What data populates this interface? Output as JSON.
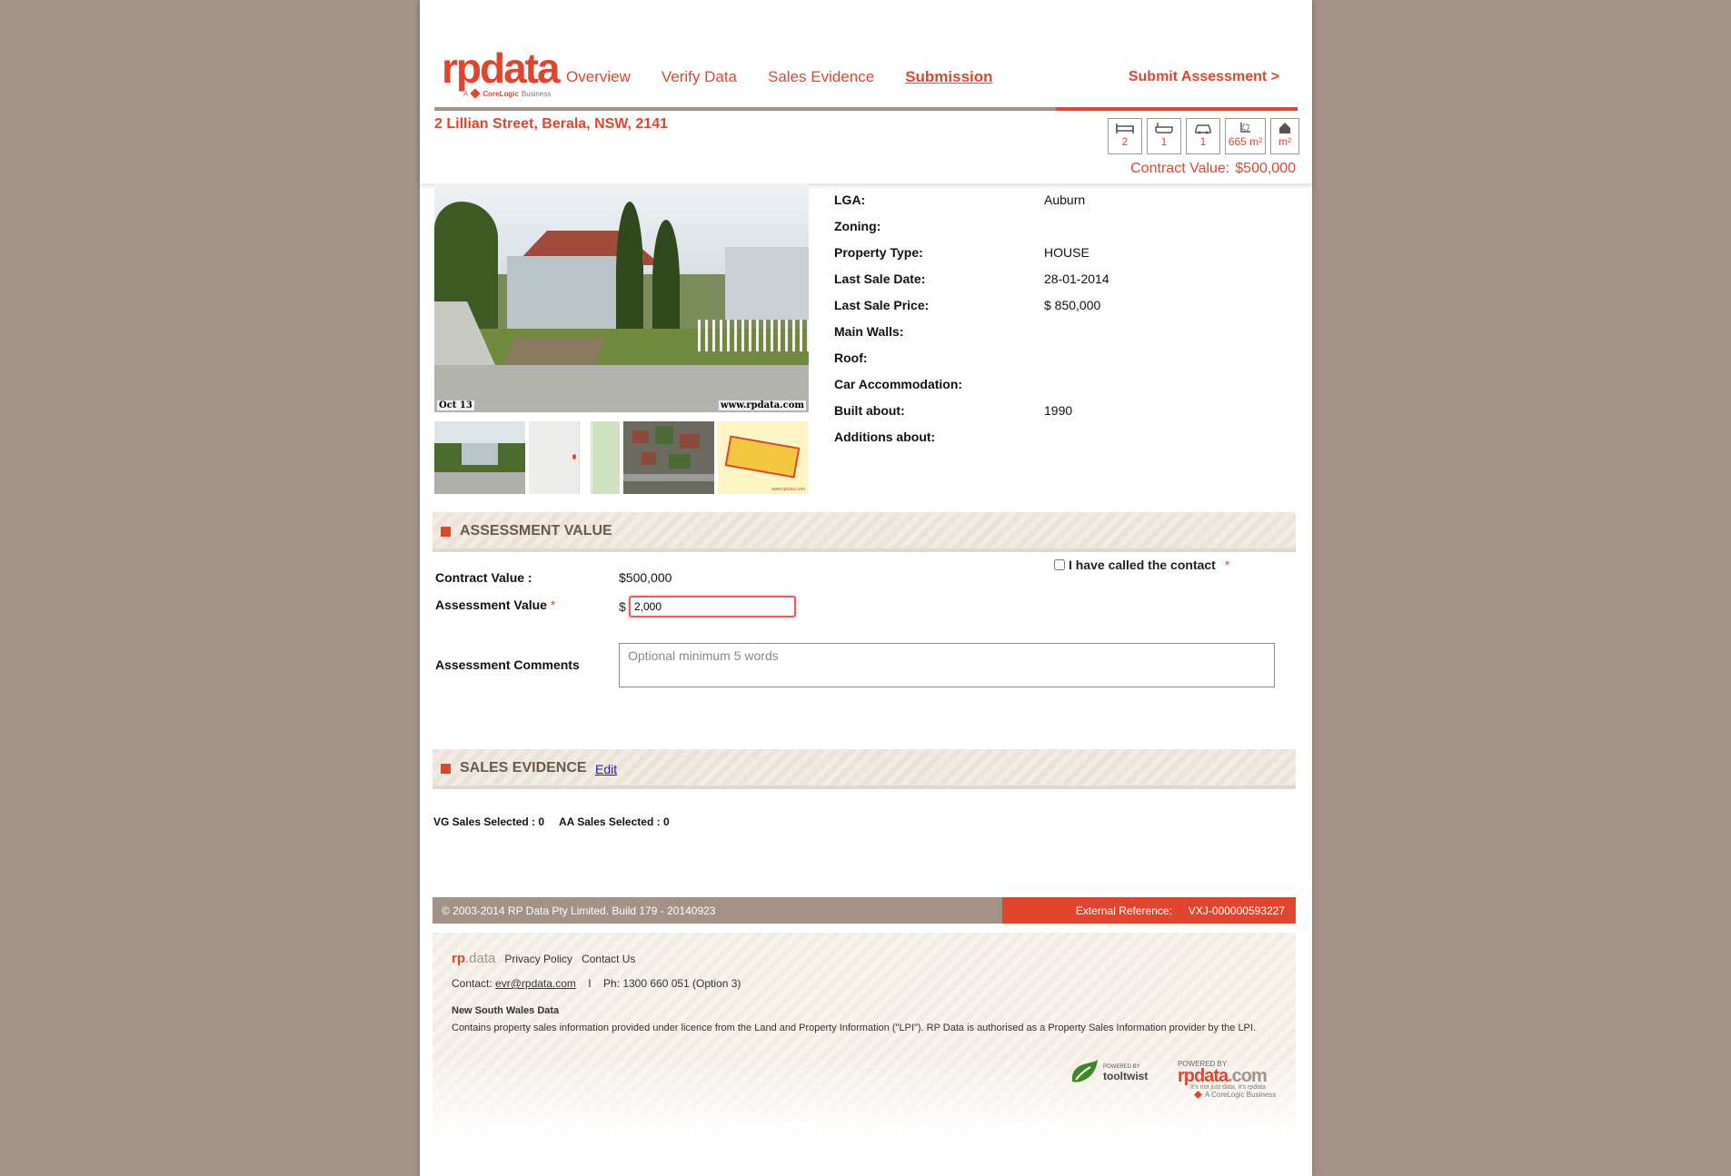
{
  "header": {
    "logo_text": "rpdata",
    "logo_sub_prefix": "A",
    "logo_sub_brand": "CoreLogic",
    "logo_sub_suffix": "Business",
    "nav": [
      "Overview",
      "Verify Data",
      "Sales Evidence",
      "Submission"
    ],
    "active_nav": "Submission",
    "submit_label": "Submit Assessment >",
    "progress_percent": 28
  },
  "property": {
    "address": "2 Lillian Street, Berala, NSW, 2141",
    "features": [
      {
        "icon": "bed-icon",
        "value": "2"
      },
      {
        "icon": "bath-icon",
        "value": "1"
      },
      {
        "icon": "car-icon",
        "value": "1"
      },
      {
        "icon": "land-area-icon",
        "value": "665 m²"
      },
      {
        "icon": "floor-area-icon",
        "value": "m²"
      }
    ],
    "contract_value_label": "Contract Value:",
    "contract_value": "$500,000",
    "photo_date": "Oct 13",
    "photo_watermark": "www.rpdata.com",
    "details": [
      {
        "label": "LGA:",
        "value": "Auburn"
      },
      {
        "label": "Zoning:",
        "value": ""
      },
      {
        "label": "Property Type:",
        "value": "HOUSE"
      },
      {
        "label": "Last Sale Date:",
        "value": "28-01-2014"
      },
      {
        "label": "Last Sale Price:",
        "value": "$ 850,000"
      },
      {
        "label": "Main Walls:",
        "value": ""
      },
      {
        "label": "Roof:",
        "value": ""
      },
      {
        "label": "Car Accommodation:",
        "value": ""
      },
      {
        "label": "Built about:",
        "value": "1990"
      },
      {
        "label": "Additions about:",
        "value": ""
      }
    ]
  },
  "assessment": {
    "title": "ASSESSMENT VALUE",
    "called_contact_label": "I have called the contact",
    "required_mark": "*",
    "contract_value_label": "Contract Value :",
    "contract_value": "$500,000",
    "assessment_value_label": "Assessment Value",
    "currency": "$",
    "assessment_value": "2,000",
    "comments_label": "Assessment Comments",
    "comments_placeholder": "Optional minimum 5 words"
  },
  "sales_evidence": {
    "title": "SALES EVIDENCE",
    "edit_label": "Edit",
    "vg_selected": "VG Sales Selected : 0",
    "aa_selected": "AA Sales Selected : 0"
  },
  "footer": {
    "copyright": "© 2003-2014 RP Data Pty Limited.  Build 179 - 20140923",
    "ext_ref_label": "External Reference:",
    "ext_ref_value": "VXJ-000000593227",
    "brand_rp": "rp",
    "brand_data": ".data",
    "links": [
      "Privacy Policy",
      "Contact Us"
    ],
    "contact_label": "Contact:",
    "contact_email": "evr@rpdata.com",
    "separator": "I",
    "phone": "Ph: 1300 660 051 (Option 3)",
    "nsw_title": "New South Wales Data",
    "licence_text": "Contains property sales information provided under licence from the Land and Property Information (\"LPI\"). RP Data is authorised as a Property Sales Information provider by the LPI.",
    "tooltwist_small": "POWERED BY",
    "tooltwist_name": "tooltwist",
    "rp_powered": "POWERED BY",
    "rp_site_main": "rpdata",
    "rp_site_tld": ".com",
    "rp_tagline": "It's not just data, it's rpdata",
    "rp_corelogic": "A   CoreLogic Business"
  }
}
